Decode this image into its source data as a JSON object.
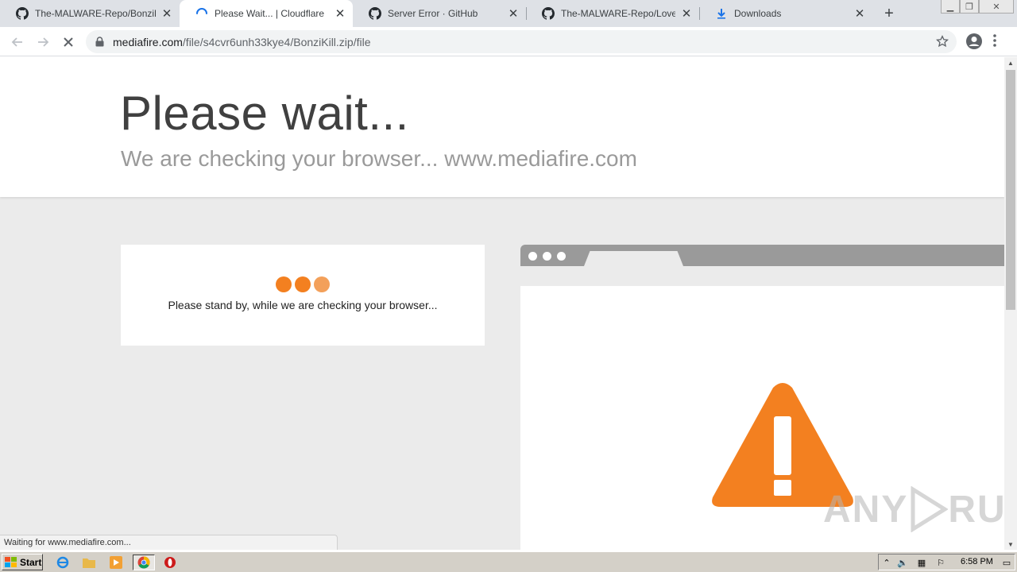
{
  "browser": {
    "tabs": [
      {
        "title": "The-MALWARE-Repo/BonziKill.bat",
        "icon": "github-icon",
        "active": false
      },
      {
        "title": "Please Wait... | Cloudflare",
        "icon": "loading-spinner-icon",
        "active": true
      },
      {
        "title": "Server Error · GitHub",
        "icon": "github-icon",
        "active": false
      },
      {
        "title": "The-MALWARE-Repo/LoveYou.exe",
        "icon": "github-icon",
        "active": false
      },
      {
        "title": "Downloads",
        "icon": "download-icon",
        "active": false
      }
    ],
    "new_tab_label": "+",
    "url_domain": "mediafire.com",
    "url_path": "/file/s4cvr6unh33kye4/BonziKill.zip/file",
    "status_text": "Waiting for www.mediafire.com..."
  },
  "page": {
    "title": "Please wait...",
    "subtitle": "We are checking your browser... www.mediafire.com",
    "standby_text": "Please stand by, while we are checking your browser...",
    "accent_color": "#f38020"
  },
  "watermark": {
    "left": "ANY",
    "right": "RUN"
  },
  "taskbar": {
    "start_label": "Start",
    "clock": "6:58 PM"
  }
}
